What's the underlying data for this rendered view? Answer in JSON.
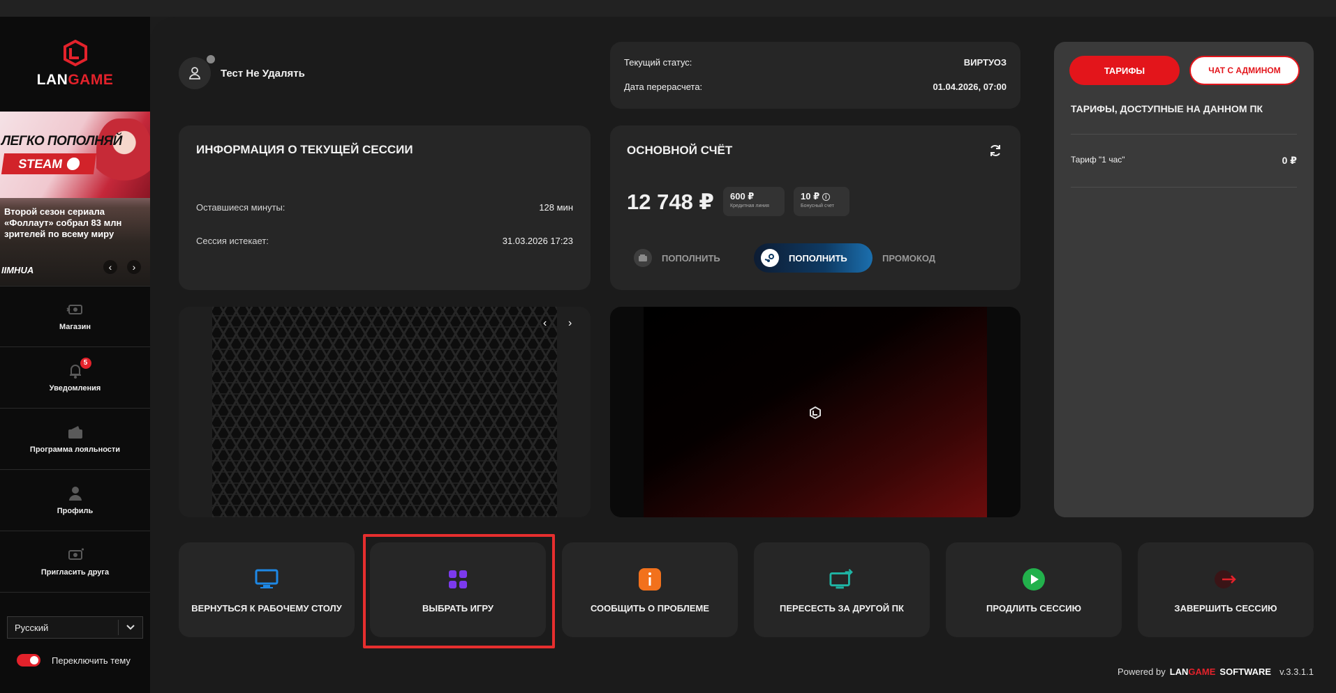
{
  "app": {
    "logo_lan": "LAN",
    "logo_game": "GAME"
  },
  "promo": {
    "headline": "ЛЕГКО ПОПОЛНЯЙ",
    "steam": "STEAM",
    "text": "Второй сезон сериала «Фоллаут» собрал 83 млн зрителей по всему миру",
    "brand": "IIMHUA",
    "prev": "‹",
    "next": "›"
  },
  "sidebar": {
    "items": [
      {
        "label": "Магазин",
        "icon": "shop-icon"
      },
      {
        "label": "Уведомления",
        "icon": "bell-icon",
        "badge": "5"
      },
      {
        "label": "Программа лояльности",
        "icon": "wallet-icon"
      },
      {
        "label": "Профиль",
        "icon": "user-icon"
      },
      {
        "label": "Пригласить друга",
        "icon": "invite-icon"
      }
    ],
    "language": "Русский",
    "theme_label": "Переключить тему"
  },
  "user": {
    "name": "Тест Не Удалять"
  },
  "status": {
    "status_label": "Текущий статус:",
    "status_value": "ВИРТУОЗ",
    "recalc_label": "Дата перерасчета:",
    "recalc_value": "01.04.2026, 07:00"
  },
  "session": {
    "title": "ИНФОРМАЦИЯ О ТЕКУЩЕЙ СЕССИИ",
    "minutes_label": "Оставшиеся минуты:",
    "minutes_value": "128 мин",
    "expires_label": "Сессия истекает:",
    "expires_value": "31.03.2026 17:23"
  },
  "account": {
    "title": "ОСНОВНОЙ СЧЁТ",
    "balance": "12 748 ₽",
    "credit_amount": "600 ₽",
    "credit_label": "Кредитная линия",
    "bonus_amount": "10 ₽",
    "bonus_label": "Бонусный счет",
    "topup_label": "ПОПОЛНИТЬ",
    "steam_topup_label": "ПОПОЛНИТЬ",
    "promo_label": "ПРОМОКОД"
  },
  "carousel": {
    "prev": "‹",
    "next": "›"
  },
  "actions": [
    {
      "label": "ВЕРНУТЬСЯ К РАБОЧЕМУ СТОЛУ",
      "icon": "monitor-icon",
      "color": "#1e88e5"
    },
    {
      "label": "ВЫБРАТЬ ИГРУ",
      "icon": "grid-icon",
      "color": "#7c3aed"
    },
    {
      "label": "СООБЩИТЬ О ПРОБЛЕМЕ",
      "icon": "info-icon",
      "color": "#f2711c"
    },
    {
      "label": "ПЕРЕСЕСТЬ ЗА ДРУГОЙ ПК",
      "icon": "switch-pc-icon",
      "color": "#1fb5a5"
    },
    {
      "label": "ПРОДЛИТЬ СЕССИЮ",
      "icon": "play-icon",
      "color": "#22b14c"
    },
    {
      "label": "ЗАВЕРШИТЬ СЕССИЮ",
      "icon": "exit-icon",
      "color": "#e3222b"
    }
  ],
  "right_panel": {
    "tariffs_button": "ТАРИФЫ",
    "chat_button": "ЧАТ С АДМИНОМ",
    "title": "ТАРИФЫ, ДОСТУПНЫЕ НА ДАННОМ ПК",
    "tariff_name": "Тариф \"1 час\"",
    "tariff_price": "0 ₽"
  },
  "footer": {
    "powered": "Powered by",
    "lan": "LAN",
    "game": "GAME",
    "software": "SOFTWARE",
    "version": "v.3.3.1.1"
  },
  "colors": {
    "accent": "#e3222b",
    "panel": "#262626",
    "background": "#1b1b1b"
  }
}
